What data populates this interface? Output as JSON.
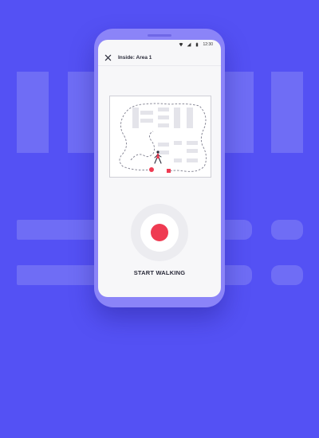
{
  "status_bar": {
    "time": "12:30",
    "icons": [
      "wifi-icon",
      "signal-icon",
      "battery-icon"
    ]
  },
  "app_bar": {
    "title": "Inside: Area 1",
    "close_icon": "close-icon"
  },
  "map": {
    "icons": [
      "walking-person-icon",
      "start-marker",
      "end-marker"
    ]
  },
  "record": {
    "label": "START WALKING"
  },
  "colors": {
    "background": "#5451f4",
    "phone_frame": "#8b84f8",
    "record_button": "#ef3b52",
    "title_text": "#2a2b3a"
  }
}
